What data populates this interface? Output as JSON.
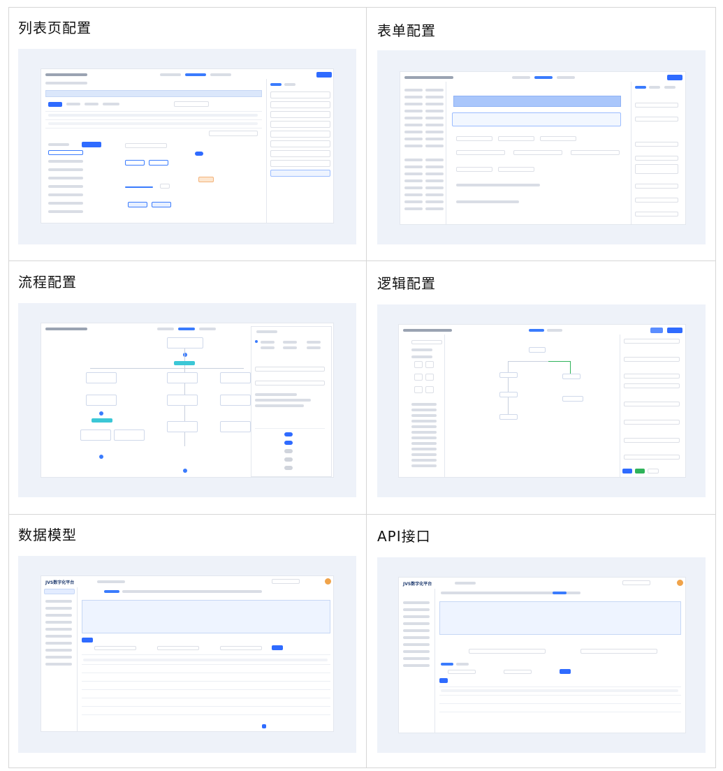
{
  "cells": {
    "list_page": {
      "title": "列表页配置"
    },
    "form": {
      "title": "表单配置"
    },
    "flow": {
      "title": "流程配置"
    },
    "logic": {
      "title": "逻辑配置"
    },
    "data_model": {
      "title": "数据模型",
      "logo_text": "JVS数字化平台"
    },
    "api": {
      "title": "API接口",
      "logo_text": "JVS数字化平台"
    }
  },
  "colors": {
    "accent": "#2f6bff",
    "green": "#2fb35a",
    "panel_bg": "#eef2f9"
  }
}
